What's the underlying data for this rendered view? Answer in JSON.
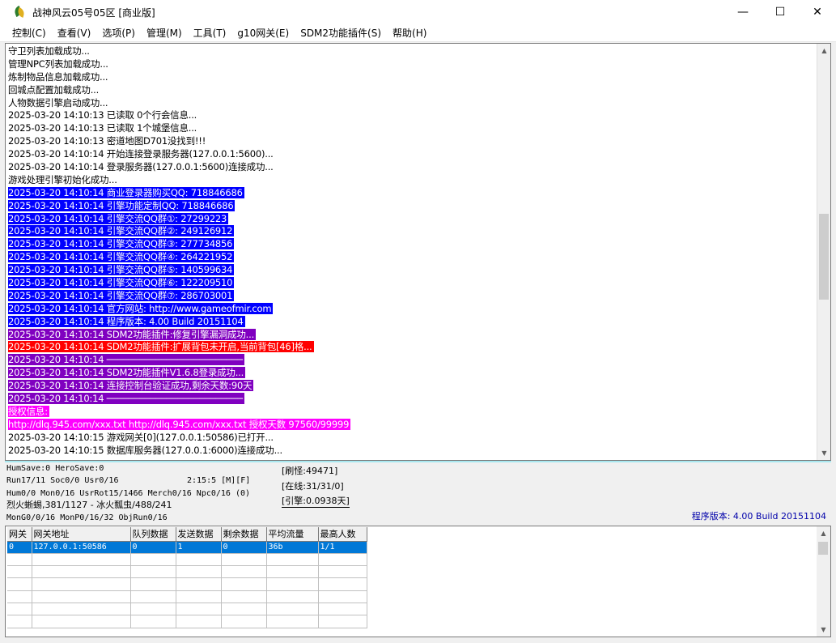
{
  "window": {
    "title": "战神风云05号05区 [商业版]",
    "minimize": "—",
    "maximize": "☐",
    "close": "✕"
  },
  "menu": [
    "控制(C)",
    "查看(V)",
    "选项(P)",
    "管理(M)",
    "工具(T)",
    "g10网关(E)",
    "SDM2功能插件(S)",
    "帮助(H)"
  ],
  "log": [
    {
      "text": "守卫列表加载成功...",
      "bg": "",
      "fg": "#000000"
    },
    {
      "text": "管理NPC列表加载成功...",
      "bg": "",
      "fg": "#000000"
    },
    {
      "text": "炼制物品信息加载成功...",
      "bg": "",
      "fg": "#000000"
    },
    {
      "text": "回城点配置加载成功...",
      "bg": "",
      "fg": "#000000"
    },
    {
      "text": "人物数据引擎启动成功...",
      "bg": "",
      "fg": "#000000"
    },
    {
      "text": "2025-03-20 14:10:13 已读取 0个行会信息...",
      "bg": "",
      "fg": "#000000"
    },
    {
      "text": "2025-03-20 14:10:13 已读取 1个城堡信息...",
      "bg": "",
      "fg": "#000000"
    },
    {
      "text": "2025-03-20 14:10:13 密道地图D701没找到!!!",
      "bg": "",
      "fg": "#000000"
    },
    {
      "text": "2025-03-20 14:10:14 开始连接登录服务器(127.0.0.1:5600)...",
      "bg": "",
      "fg": "#000000"
    },
    {
      "text": "2025-03-20 14:10:14 登录服务器(127.0.0.1:5600)连接成功...",
      "bg": "",
      "fg": "#000000"
    },
    {
      "text": "游戏处理引擎初始化成功...",
      "bg": "",
      "fg": "#000000"
    },
    {
      "text": "2025-03-20 14:10:14 商业登录器购买QQ: 718846686",
      "bg": "#0000ff",
      "fg": "#ffffff"
    },
    {
      "text": "2025-03-20 14:10:14 引擎功能定制QQ: 718846686",
      "bg": "#0000ff",
      "fg": "#ffffff"
    },
    {
      "text": "2025-03-20 14:10:14 引擎交流QQ群①: 27299223",
      "bg": "#0000ff",
      "fg": "#ffffff"
    },
    {
      "text": "2025-03-20 14:10:14 引擎交流QQ群②: 249126912",
      "bg": "#0000ff",
      "fg": "#ffffff"
    },
    {
      "text": "2025-03-20 14:10:14 引擎交流QQ群③: 277734856",
      "bg": "#0000ff",
      "fg": "#ffffff"
    },
    {
      "text": "2025-03-20 14:10:14 引擎交流QQ群④: 264221952",
      "bg": "#0000ff",
      "fg": "#ffffff"
    },
    {
      "text": "2025-03-20 14:10:14 引擎交流QQ群⑤: 140599634",
      "bg": "#0000ff",
      "fg": "#ffffff"
    },
    {
      "text": "2025-03-20 14:10:14 引擎交流QQ群⑥: 122209510",
      "bg": "#0000ff",
      "fg": "#ffffff"
    },
    {
      "text": "2025-03-20 14:10:14 引擎交流QQ群⑦: 286703001",
      "bg": "#0000ff",
      "fg": "#ffffff"
    },
    {
      "text": "2025-03-20 14:10:14 官方网站: http://www.gameofmir.com",
      "bg": "#0000ff",
      "fg": "#ffffff"
    },
    {
      "text": "2025-03-20 14:10:14 程序版本: 4.00 Build 20151104",
      "bg": "#0000ff",
      "fg": "#ffffff"
    },
    {
      "text": "2025-03-20 14:10:14 SDM2功能插件:修复引擎漏洞成功...",
      "bg": "#8000c0",
      "fg": "#ffffff"
    },
    {
      "text": "2025-03-20 14:10:14 SDM2功能插件:扩展背包未开启,当前背包[46]格...",
      "bg": "#ff0000",
      "fg": "#ffffff"
    },
    {
      "text": "2025-03-20 14:10:14 ─────────────────────────",
      "bg": "#8000c0",
      "fg": "#ffffff"
    },
    {
      "text": "2025-03-20 14:10:14 SDM2功能插件V1.6.8登录成功...",
      "bg": "#8000c0",
      "fg": "#ffffff"
    },
    {
      "text": "2025-03-20 14:10:14 连接控制台验证成功,剩余天数:90天",
      "bg": "#8000c0",
      "fg": "#ffffff"
    },
    {
      "text": "2025-03-20 14:10:14 ─────────────────────────",
      "bg": "#8000c0",
      "fg": "#ffffff"
    },
    {
      "text": "授权信息:",
      "bg": "#ff00ff",
      "fg": "#ffffff"
    },
    {
      "text": "http://dlq.945.com/xxx.txt http://dlq.945.com/xxx.txt 授权天数 97560/99999",
      "bg": "#ff00ff",
      "fg": "#ffffff"
    },
    {
      "text": "2025-03-20 14:10:15 游戏网关[0](127.0.0.1:50586)已打开...",
      "bg": "",
      "fg": "#000000"
    },
    {
      "text": "2025-03-20 14:10:15 数据库服务器(127.0.0.1:6000)连接成功...",
      "bg": "",
      "fg": "#000000"
    }
  ],
  "status": {
    "humsave": "HumSave:0 HeroSave:0",
    "run": "Run17/11 Soc0/0 Usr0/16",
    "time": "2:15:5 [M][F]",
    "hum": "Hum0/0 Mon0/16 UsrRot15/1466 Merch0/16 Npc0/16 (0)",
    "mon": "烈火蜥蜴,381/1127 - 冰火瓢虫/488/241",
    "mong": "MonG0/0/16 MonP0/16/32 ObjRun0/16",
    "refresh": "[刷怪:49471]",
    "online": "[在线:31/31/0]",
    "engine": "[引擎:0.0938天]",
    "build": "程序版本: 4.00 Build 20151104"
  },
  "gateway_table": {
    "headers": [
      "网关",
      "网关地址",
      "队列数据",
      "发送数据",
      "剩余数据",
      "平均流量",
      "最高人数"
    ],
    "rows": [
      [
        "0",
        "127.0.0.1:50586",
        "0",
        "1",
        "0",
        "36b",
        "1/1"
      ]
    ],
    "empty_rows": 6
  },
  "colors": {
    "selection": "#0078d7",
    "build_text": "#0000aa"
  }
}
